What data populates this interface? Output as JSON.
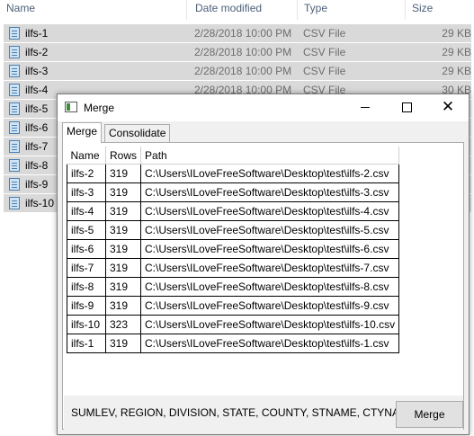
{
  "explorer": {
    "columns": {
      "name": "Name",
      "date": "Date modified",
      "type": "Type",
      "size": "Size"
    },
    "files": [
      {
        "name": "ilfs-1",
        "date": "2/28/2018 10:00 PM",
        "type": "CSV File",
        "size": "29 KB"
      },
      {
        "name": "ilfs-2",
        "date": "2/28/2018 10:00 PM",
        "type": "CSV File",
        "size": "29 KB"
      },
      {
        "name": "ilfs-3",
        "date": "2/28/2018 10:00 PM",
        "type": "CSV File",
        "size": "29 KB"
      },
      {
        "name": "ilfs-4",
        "date": "2/28/2018 10:00 PM",
        "type": "CSV File",
        "size": "30 KB"
      },
      {
        "name": "ilfs-5",
        "date": "",
        "type": "",
        "size": ""
      },
      {
        "name": "ilfs-6",
        "date": "",
        "type": "",
        "size": ""
      },
      {
        "name": "ilfs-7",
        "date": "",
        "type": "",
        "size": ""
      },
      {
        "name": "ilfs-8",
        "date": "",
        "type": "",
        "size": ""
      },
      {
        "name": "ilfs-9",
        "date": "",
        "type": "",
        "size": ""
      },
      {
        "name": "ilfs-10",
        "date": "",
        "type": "",
        "size": ""
      }
    ],
    "icon": "csv-file-icon"
  },
  "dialog": {
    "title": "Merge",
    "window_icons": {
      "minimize": "minimize-icon",
      "maximize": "maximize-icon",
      "close": "close-icon"
    },
    "tabs": [
      {
        "label": "Merge"
      },
      {
        "label": "Consolidate"
      }
    ],
    "grid": {
      "headers": {
        "name": "Name",
        "rows": "Rows",
        "path": "Path"
      },
      "rows": [
        {
          "name": "ilfs-2",
          "rows": "319",
          "path": "C:\\Users\\ILoveFreeSoftware\\Desktop\\test\\ilfs-2.csv"
        },
        {
          "name": "ilfs-3",
          "rows": "319",
          "path": "C:\\Users\\ILoveFreeSoftware\\Desktop\\test\\ilfs-3.csv"
        },
        {
          "name": "ilfs-4",
          "rows": "319",
          "path": "C:\\Users\\ILoveFreeSoftware\\Desktop\\test\\ilfs-4.csv"
        },
        {
          "name": "ilfs-5",
          "rows": "319",
          "path": "C:\\Users\\ILoveFreeSoftware\\Desktop\\test\\ilfs-5.csv"
        },
        {
          "name": "ilfs-6",
          "rows": "319",
          "path": "C:\\Users\\ILoveFreeSoftware\\Desktop\\test\\ilfs-6.csv"
        },
        {
          "name": "ilfs-7",
          "rows": "319",
          "path": "C:\\Users\\ILoveFreeSoftware\\Desktop\\test\\ilfs-7.csv"
        },
        {
          "name": "ilfs-8",
          "rows": "319",
          "path": "C:\\Users\\ILoveFreeSoftware\\Desktop\\test\\ilfs-8.csv"
        },
        {
          "name": "ilfs-9",
          "rows": "319",
          "path": "C:\\Users\\ILoveFreeSoftware\\Desktop\\test\\ilfs-9.csv"
        },
        {
          "name": "ilfs-10",
          "rows": "323",
          "path": "C:\\Users\\ILoveFreeSoftware\\Desktop\\test\\ilfs-10.csv"
        },
        {
          "name": "ilfs-1",
          "rows": "319",
          "path": "C:\\Users\\ILoveFreeSoftware\\Desktop\\test\\ilfs-1.csv"
        }
      ]
    },
    "columns_text": "SUMLEV, REGION, DIVISION, STATE, COUNTY, STNAME, CTYNAME",
    "merge_button": "Merge"
  }
}
